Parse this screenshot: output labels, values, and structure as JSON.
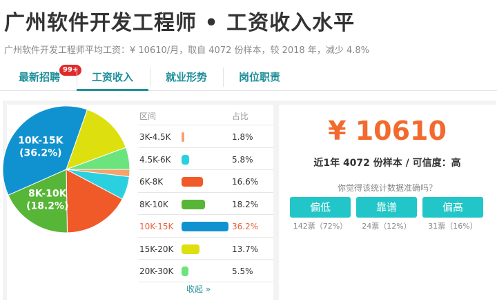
{
  "header": {
    "title": "广州软件开发工程师 • 工资收入水平",
    "subtitle": "广州软件开发工程师平均工资：¥ 10610/月，取自 4072 份样本，较 2018 年，减少 4.8%"
  },
  "tabs": [
    {
      "label": "最新招聘",
      "badge": "99+",
      "active": false
    },
    {
      "label": "工资收入",
      "active": true
    },
    {
      "label": "就业形势",
      "active": false
    },
    {
      "label": "岗位职责",
      "active": false
    }
  ],
  "table": {
    "col_range": "区间",
    "col_share": "占比",
    "collapse_label": "收起 »"
  },
  "chart_data": {
    "type": "pie",
    "categories": [
      "3K-4.5K",
      "4.5K-6K",
      "6K-8K",
      "8K-10K",
      "10K-15K",
      "15K-20K",
      "20K-30K"
    ],
    "values": [
      1.8,
      5.8,
      16.6,
      18.2,
      36.2,
      13.7,
      5.5
    ],
    "labels": [
      "1.8%",
      "5.8%",
      "16.6%",
      "18.2%",
      "36.2%",
      "13.7%",
      "5.5%"
    ],
    "colors": [
      "#f6a26a",
      "#2bd0e0",
      "#ef5a28",
      "#57b637",
      "#1192d0",
      "#dddf0f",
      "#6be47e"
    ],
    "highlight": "10K-15K",
    "slice_labels": [
      {
        "category": "10K-15K",
        "line1": "10K-15K",
        "line2": "(36.2%)"
      },
      {
        "category": "8K-10K",
        "line1": "8K-10K",
        "line2": "(18.2%)"
      }
    ]
  },
  "summary": {
    "salary": "¥ 10610",
    "sample_text": "近1年 4072 份样本 / 可信度：高",
    "question": "你觉得该统计数据准确吗？",
    "votes": [
      {
        "label": "偏低",
        "count": "142票（72%）"
      },
      {
        "label": "靠谱",
        "count": "24票（12%）"
      },
      {
        "label": "偏高",
        "count": "31票（16%）"
      }
    ]
  }
}
